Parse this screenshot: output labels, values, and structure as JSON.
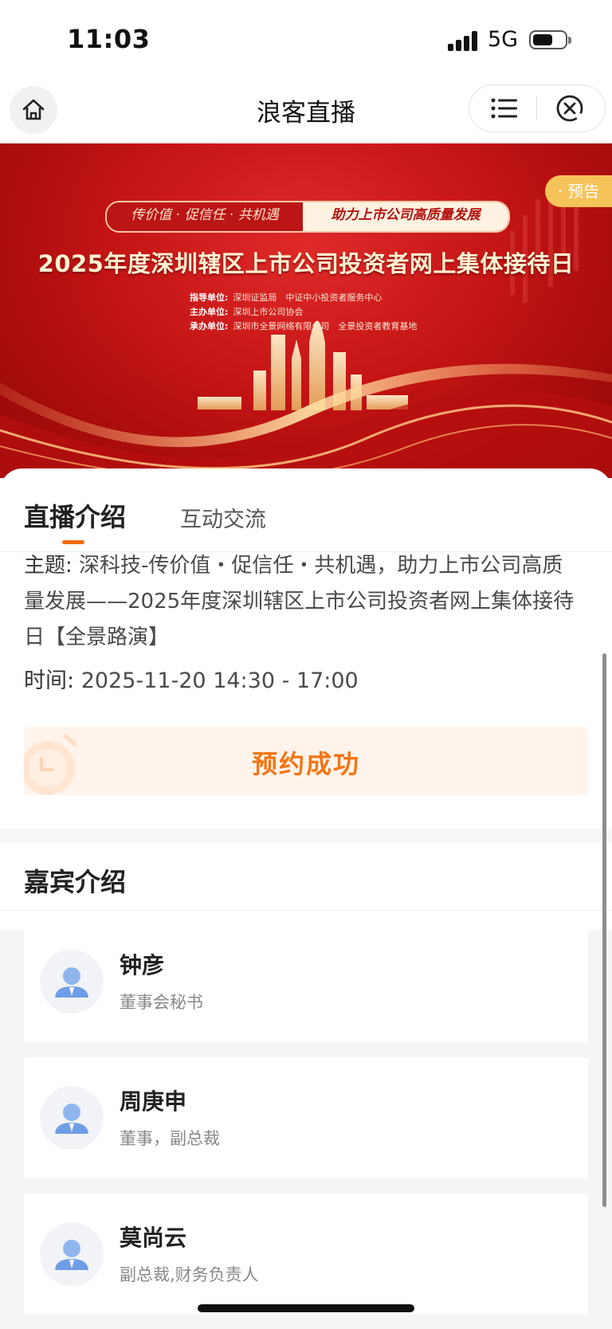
{
  "status": {
    "time": "11:03",
    "network": "5G"
  },
  "nav": {
    "title": "浪客直播"
  },
  "banner": {
    "badge": "· 预告",
    "slogan_left": "传价值 · 促信任 · 共机遇",
    "slogan_right": "助力上市公司高质量发展",
    "headline": "2025年度深圳辖区上市公司投资者网上集体接待日",
    "org": [
      {
        "label": "指导单位:",
        "value": "深圳证监局　中证中小投资者服务中心"
      },
      {
        "label": "主办单位:",
        "value": "深圳上市公司协会"
      },
      {
        "label": "承办单位:",
        "value": "深圳市全景网络有限公司　全景投资者教育基地"
      }
    ]
  },
  "tabs": {
    "live_intro": "直播介绍",
    "interaction": "互动交流"
  },
  "intro": {
    "topic_label": "主题:",
    "topic_text": "深科技-传价值・促信任・共机遇，助力上市公司高质量发展——2025年度深圳辖区上市公司投资者网上集体接待日【全景路演】",
    "time_label": "时间:",
    "time_value": "2025-11-20 14:30 - 17:00",
    "reserve_status": "预约成功"
  },
  "guests": {
    "heading": "嘉宾介绍",
    "items": [
      {
        "name": "钟彦",
        "role": "董事会秘书"
      },
      {
        "name": "周庚申",
        "role": "董事，副总裁"
      },
      {
        "name": "莫尚云",
        "role": "副总裁,财务负责人"
      }
    ]
  },
  "colors": {
    "accent": "#f47515",
    "banner_red": "#c41414",
    "badge": "#f6c35a"
  }
}
